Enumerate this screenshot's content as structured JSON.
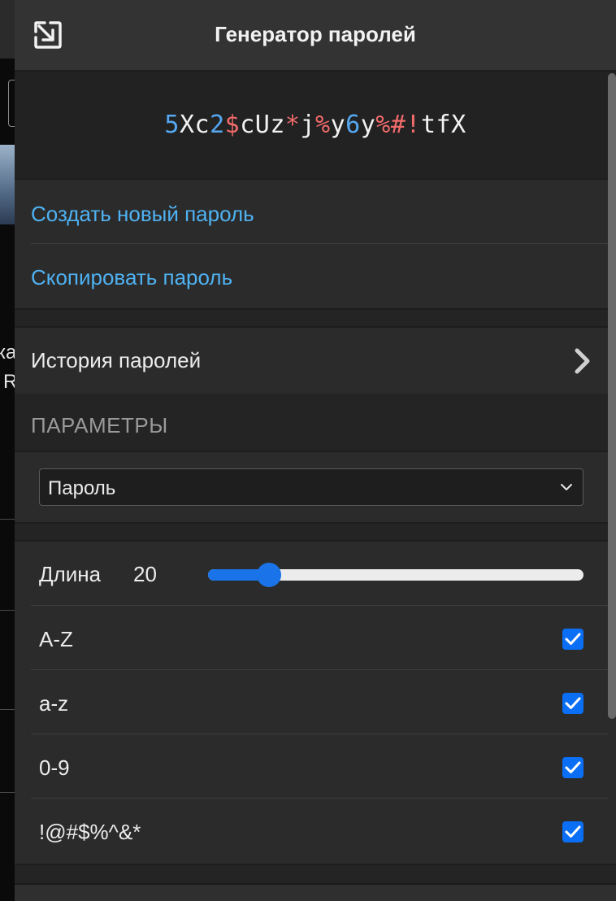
{
  "header": {
    "title": "Генератор паролей",
    "icon": "detach-icon"
  },
  "password": {
    "chars": [
      {
        "c": "5",
        "t": "digit"
      },
      {
        "c": "X",
        "t": "letter"
      },
      {
        "c": "c",
        "t": "letter"
      },
      {
        "c": "2",
        "t": "digit"
      },
      {
        "c": "$",
        "t": "symbol"
      },
      {
        "c": "c",
        "t": "letter"
      },
      {
        "c": "U",
        "t": "letter"
      },
      {
        "c": "z",
        "t": "letter"
      },
      {
        "c": "*",
        "t": "symbol"
      },
      {
        "c": "j",
        "t": "letter"
      },
      {
        "c": "%",
        "t": "symbol"
      },
      {
        "c": "y",
        "t": "letter"
      },
      {
        "c": "6",
        "t": "digit"
      },
      {
        "c": "y",
        "t": "letter"
      },
      {
        "c": "%",
        "t": "symbol"
      },
      {
        "c": "#",
        "t": "symbol"
      },
      {
        "c": "!",
        "t": "symbol"
      },
      {
        "c": "t",
        "t": "letter"
      },
      {
        "c": "f",
        "t": "letter"
      },
      {
        "c": "X",
        "t": "letter"
      }
    ],
    "colors": {
      "letter": "#f2f2f2",
      "digit": "#55a8f2",
      "symbol": "#f26b6b"
    }
  },
  "actions": {
    "generate_label": "Создать новый пароль",
    "copy_label": "Скопировать пароль",
    "link_color": "#4fb2f2"
  },
  "history": {
    "label": "История паролей",
    "icon": "chevron-right-icon"
  },
  "params": {
    "section_label": "ПАРАМЕТРЫ",
    "type_select": {
      "value": "Пароль",
      "icon": "chevron-down-icon"
    },
    "length": {
      "label": "Длина",
      "value": "20",
      "slider_fraction": 0.14
    },
    "options": [
      {
        "label": "A-Z",
        "checked": true
      },
      {
        "label": "a-z",
        "checked": true
      },
      {
        "label": "0-9",
        "checked": true
      },
      {
        "label": "!@#$%^&*",
        "checked": true
      }
    ],
    "accent_color": "#0b6ff5"
  },
  "background": {
    "partial_text_1": "ка",
    "partial_text_2": "R"
  }
}
